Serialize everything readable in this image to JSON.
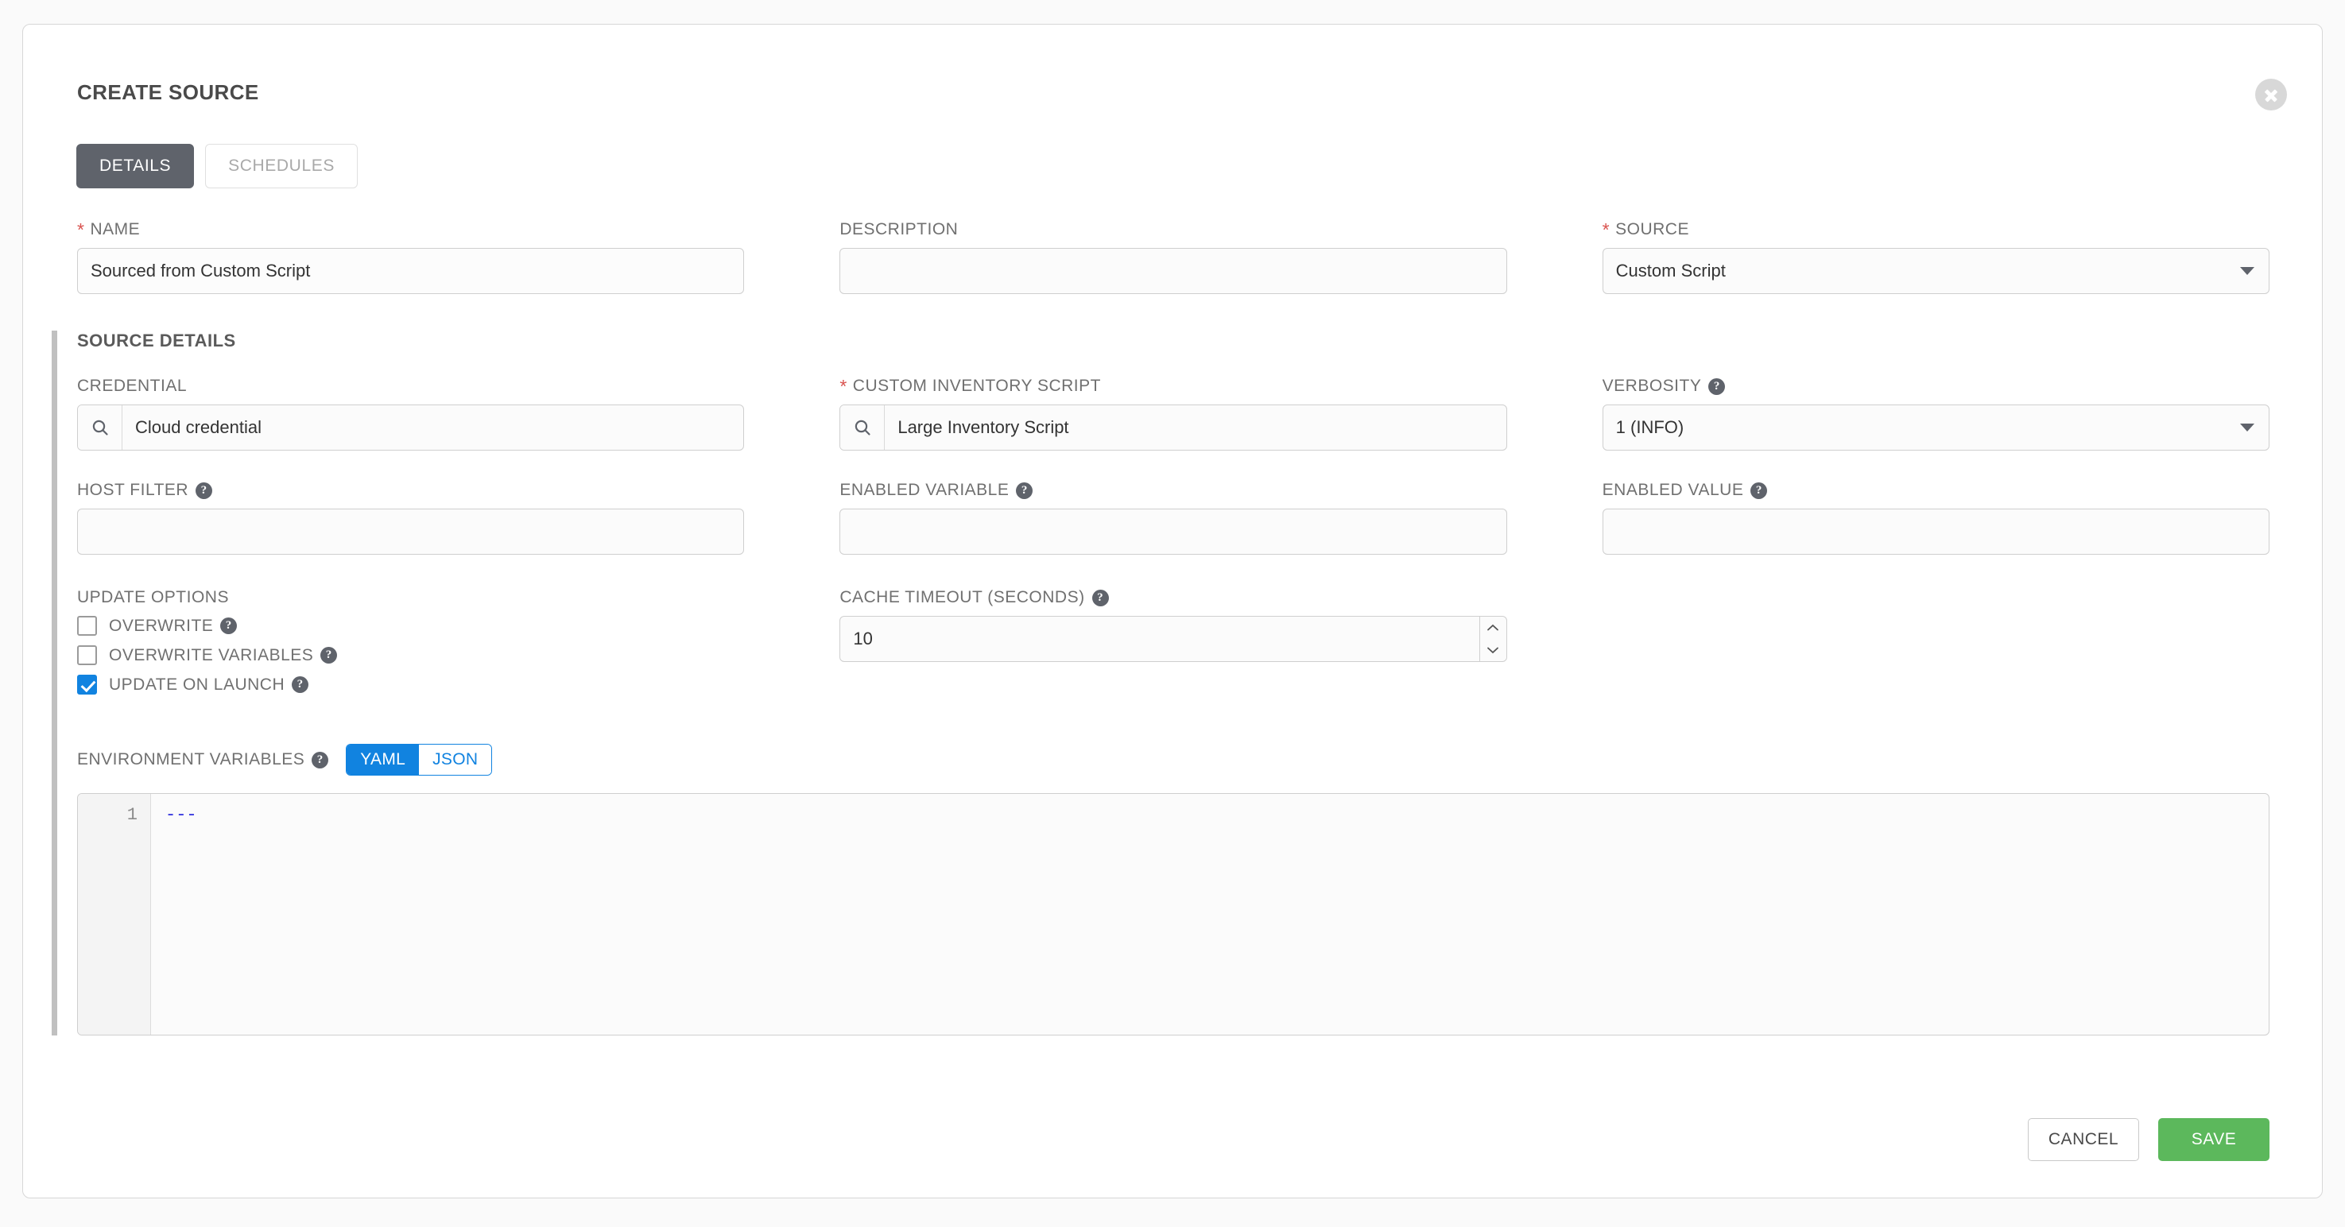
{
  "panel": {
    "title": "CREATE SOURCE",
    "close_icon": "close-icon"
  },
  "tabs": [
    {
      "label": "DETAILS",
      "active": true
    },
    {
      "label": "SCHEDULES",
      "active": false
    }
  ],
  "fields": {
    "name": {
      "label": "NAME",
      "required": true,
      "value": "Sourced from Custom Script",
      "placeholder": ""
    },
    "description": {
      "label": "DESCRIPTION",
      "required": false,
      "value": "",
      "placeholder": ""
    },
    "source": {
      "label": "SOURCE",
      "required": true,
      "value": "Custom Script"
    }
  },
  "source_details": {
    "section_title": "SOURCE DETAILS",
    "credential": {
      "label": "CREDENTIAL",
      "required": false,
      "value": "Cloud credential",
      "icon": "search-icon"
    },
    "custom_inventory_script": {
      "label": "CUSTOM INVENTORY SCRIPT",
      "required": true,
      "value": "Large Inventory Script",
      "icon": "search-icon"
    },
    "verbosity": {
      "label": "VERBOSITY",
      "required": false,
      "value": "1 (INFO)",
      "help": "?"
    },
    "host_filter": {
      "label": "HOST FILTER",
      "required": false,
      "value": "",
      "help": "?"
    },
    "enabled_variable": {
      "label": "ENABLED VARIABLE",
      "required": false,
      "value": "",
      "help": "?"
    },
    "enabled_value": {
      "label": "ENABLED VALUE",
      "required": false,
      "value": "",
      "help": "?"
    },
    "update_options": {
      "label": "UPDATE OPTIONS",
      "items": [
        {
          "label": "OVERWRITE",
          "checked": false,
          "help": "?"
        },
        {
          "label": "OVERWRITE VARIABLES",
          "checked": false,
          "help": "?"
        },
        {
          "label": "UPDATE ON LAUNCH",
          "checked": true,
          "help": "?"
        }
      ]
    },
    "cache_timeout": {
      "label": "CACHE TIMEOUT (SECONDS)",
      "value": "10",
      "help": "?"
    }
  },
  "environment_variables": {
    "label": "ENVIRONMENT VARIABLES",
    "help": "?",
    "format_options": [
      {
        "label": "YAML",
        "selected": true
      },
      {
        "label": "JSON",
        "selected": false
      }
    ],
    "line_numbers": "1",
    "content": "---"
  },
  "footer": {
    "cancel_label": "CANCEL",
    "save_label": "SAVE"
  },
  "colors": {
    "accent_blue": "#1183e0",
    "save_green": "#5cb85c",
    "required_red": "#d9534f",
    "tab_active": "#5f636b"
  }
}
